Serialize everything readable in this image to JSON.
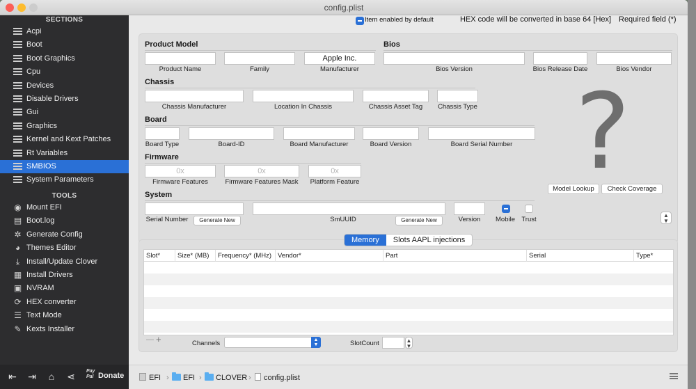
{
  "window": {
    "title": "config.plist"
  },
  "sidebar": {
    "sections_title": "SECTIONS",
    "items": [
      {
        "label": "Acpi"
      },
      {
        "label": "Boot"
      },
      {
        "label": "Boot Graphics"
      },
      {
        "label": "Cpu"
      },
      {
        "label": "Devices"
      },
      {
        "label": "Disable Drivers"
      },
      {
        "label": "Gui"
      },
      {
        "label": "Graphics"
      },
      {
        "label": "Kernel and Kext Patches"
      },
      {
        "label": "Rt Variables"
      },
      {
        "label": "SMBIOS",
        "active": true
      },
      {
        "label": "System Parameters"
      }
    ],
    "tools_title": "TOOLS",
    "tools": [
      {
        "label": "Mount EFI",
        "icon": "disk-icon"
      },
      {
        "label": "Boot.log",
        "icon": "log-icon"
      },
      {
        "label": "Generate Config",
        "icon": "gear-icon"
      },
      {
        "label": "Themes Editor",
        "icon": "palette-icon"
      },
      {
        "label": "Install/Update Clover",
        "icon": "download-icon"
      },
      {
        "label": "Install Drivers",
        "icon": "drivers-icon"
      },
      {
        "label": "NVRAM",
        "icon": "nvram-icon"
      },
      {
        "label": "HEX converter",
        "icon": "convert-icon"
      },
      {
        "label": "Text Mode",
        "icon": "text-icon"
      },
      {
        "label": "Kexts Installer",
        "icon": "kext-icon"
      }
    ],
    "bottom": {
      "donate_label": "Donate",
      "paypal_label": "Pay Pal"
    }
  },
  "header": {
    "item_enabled": "Item enabled by default",
    "hex_note": "HEX code will be converted in base 64 [Hex]",
    "required_note": "Required field (*)"
  },
  "product": {
    "title": "Product Model",
    "fields": [
      {
        "label": "Product Name",
        "value": ""
      },
      {
        "label": "Family",
        "value": ""
      },
      {
        "label": "Manufacturer",
        "value": "Apple Inc."
      }
    ]
  },
  "bios": {
    "title": "Bios",
    "fields": [
      {
        "label": "Bios Version",
        "value": ""
      },
      {
        "label": "Bios Release Date",
        "value": ""
      },
      {
        "label": "Bios Vendor",
        "value": ""
      }
    ]
  },
  "chassis": {
    "title": "Chassis",
    "fields": [
      {
        "label": "Chassis Manufacturer",
        "value": ""
      },
      {
        "label": "Location In Chassis",
        "value": ""
      },
      {
        "label": "Chassis  Asset Tag",
        "value": ""
      },
      {
        "label": "Chassis Type",
        "value": ""
      }
    ]
  },
  "board": {
    "title": "Board",
    "fields": [
      {
        "label": "Board Type",
        "value": ""
      },
      {
        "label": "Board-ID",
        "value": ""
      },
      {
        "label": "Board Manufacturer",
        "value": ""
      },
      {
        "label": "Board Version",
        "value": ""
      },
      {
        "label": "Board Serial Number",
        "value": ""
      }
    ]
  },
  "firmware": {
    "title": "Firmware",
    "fields": [
      {
        "label": "Firmware Features",
        "placeholder": "0x"
      },
      {
        "label": "Firmware Features Mask",
        "placeholder": "0x"
      },
      {
        "label": "Platform Feature",
        "placeholder": "0x"
      }
    ]
  },
  "system": {
    "title": "System",
    "serial_label": "Serial Number",
    "generate_label": "Generate New",
    "smuuid_label": "SmUUID",
    "version_label": "Version",
    "mobile_label": "Mobile",
    "trust_label": "Trust",
    "mobile_checked": true,
    "trust_checked": false
  },
  "lookup": {
    "model_lookup": "Model Lookup",
    "check_coverage": "Check Coverage",
    "question_glyph": "?"
  },
  "memory_tabs": [
    {
      "label": "Memory",
      "active": true
    },
    {
      "label": "Slots AAPL injections",
      "active": false
    }
  ],
  "memory_table": {
    "columns": [
      "Slot*",
      "Size* (MB)",
      "Frequency* (MHz)",
      "Vendor*",
      "Part",
      "Serial",
      "Type*"
    ],
    "rows": []
  },
  "memory_controls": {
    "minus": "—",
    "plus": "+",
    "channels_label": "Channels",
    "slotcount_label": "SlotCount"
  },
  "pathbar": {
    "segments": [
      "EFI",
      "EFI",
      "CLOVER",
      "config.plist"
    ],
    "separator": "›"
  },
  "colors": {
    "accent": "#2a70d6",
    "sidebar_bg": "#2d2d2f"
  }
}
